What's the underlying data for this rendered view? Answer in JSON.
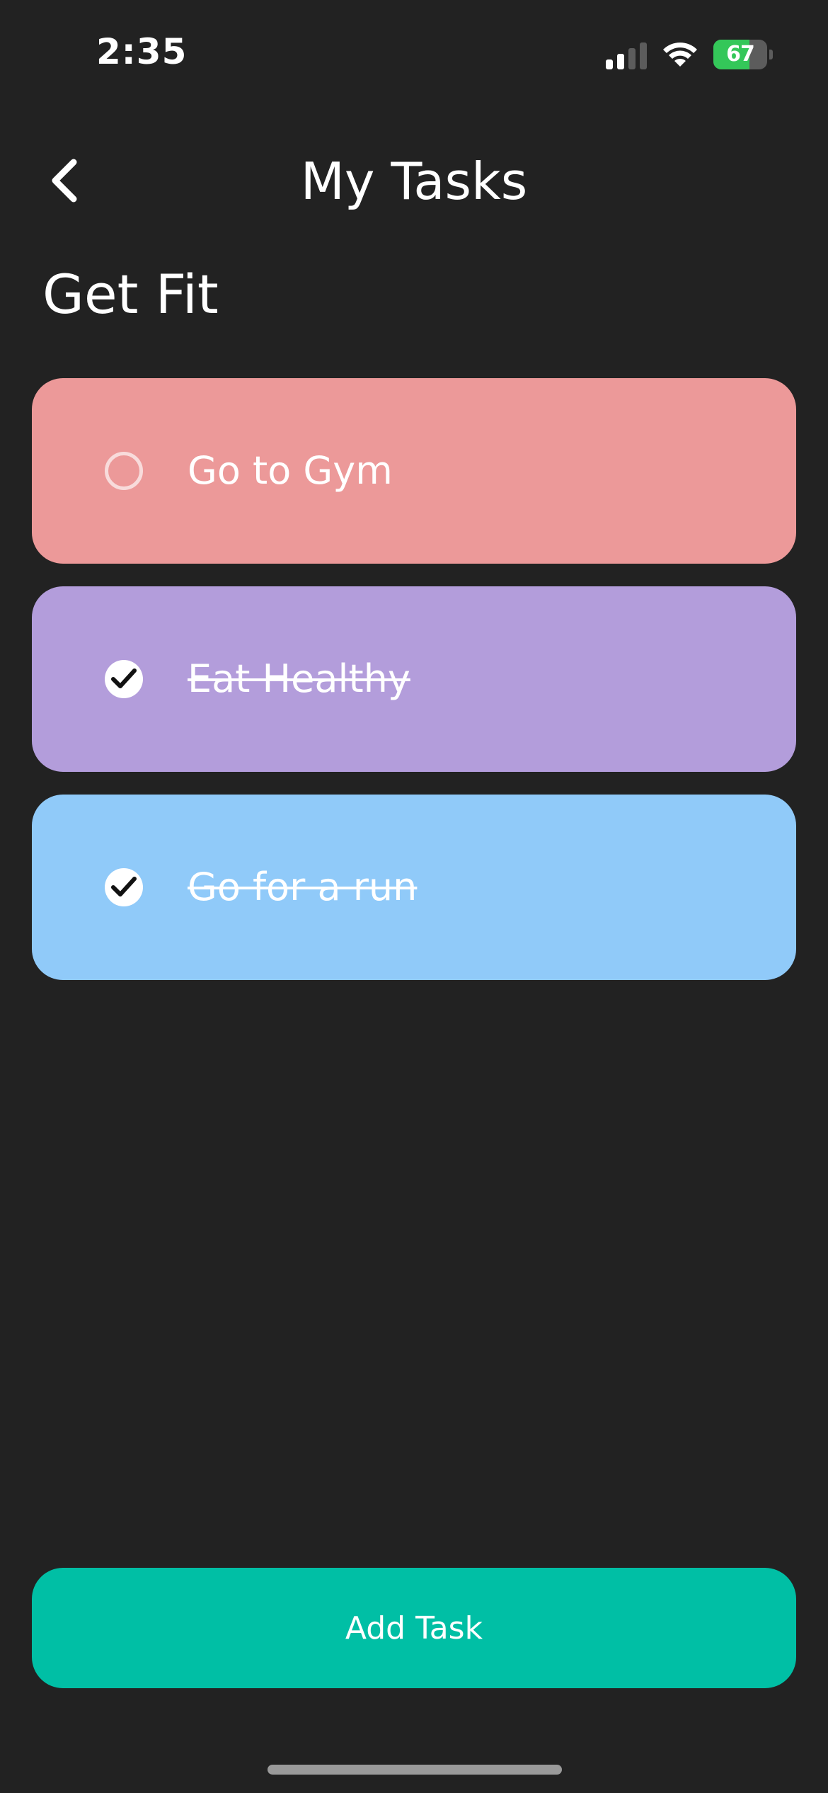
{
  "status_bar": {
    "time": "2:35",
    "battery_percent": "67",
    "battery_level": 0.67,
    "battery_color": "#34c759"
  },
  "header": {
    "title": "My Tasks",
    "back_icon": "chevron-left-icon"
  },
  "list": {
    "title": "Get Fit",
    "tasks": [
      {
        "label": "Go to Gym",
        "done": false,
        "color": "#ec9999"
      },
      {
        "label": "Eat Healthy",
        "done": true,
        "color": "#b39ddb"
      },
      {
        "label": "Go for a run",
        "done": true,
        "color": "#90caf9"
      }
    ]
  },
  "footer": {
    "add_task_label": "Add Task",
    "button_color": "#00bfa5"
  }
}
